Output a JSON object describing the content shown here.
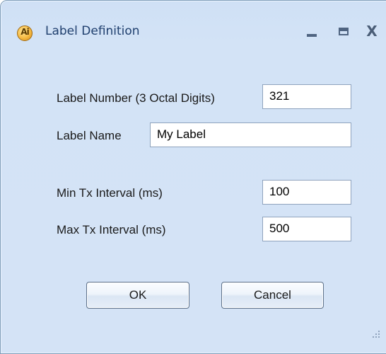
{
  "window": {
    "title": "Label Definition",
    "app_icon_text": "Ai"
  },
  "form": {
    "label_number": {
      "label": "Label Number (3 Octal Digits)",
      "value": "321"
    },
    "label_name": {
      "label": "Label Name",
      "value": "My Label"
    },
    "min_tx": {
      "label": "Min Tx Interval (ms)",
      "value": "100"
    },
    "max_tx": {
      "label": "Max Tx Interval (ms)",
      "value": "500"
    }
  },
  "buttons": {
    "ok": "OK",
    "cancel": "Cancel"
  },
  "controls": {
    "close": "X"
  }
}
